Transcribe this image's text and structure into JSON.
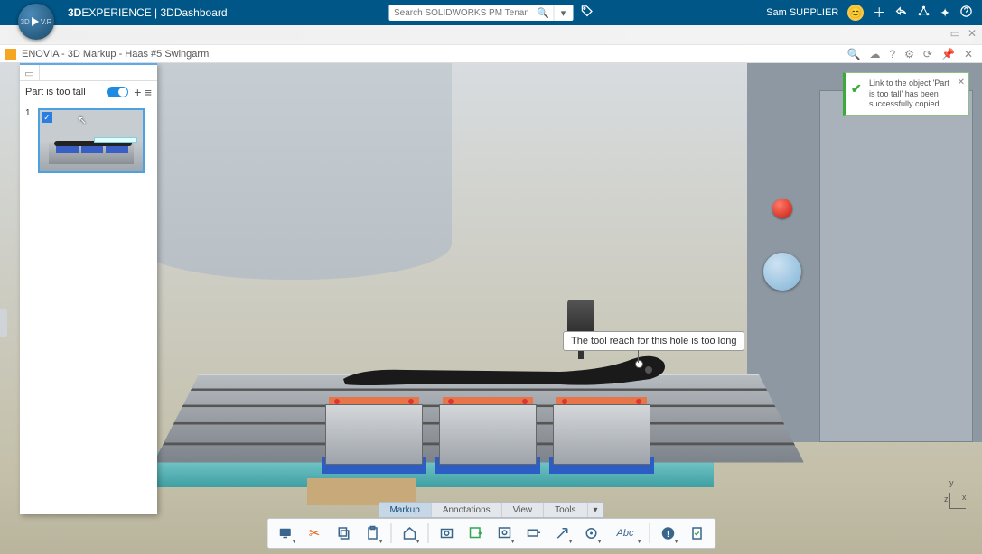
{
  "header": {
    "brand_prefix": "3D",
    "brand_mid": "EXPERIENCE",
    "brand_suffix": " | 3DDashboard",
    "search_placeholder": "Search SOLIDWORKS PM Tenant",
    "user_name": "Sam SUPPLIER"
  },
  "tab": {
    "title": "ENOVIA - 3D Markup - Haas #5 Swingarm"
  },
  "sidepanel": {
    "title": "Part is too tall",
    "slides": [
      {
        "index": "1."
      }
    ]
  },
  "callout": {
    "text": "The tool reach for this hole is too long"
  },
  "toast": {
    "text": "Link to the object 'Part is too tall' has been successfully copied"
  },
  "ribbon": {
    "tabs": [
      "Markup",
      "Annotations",
      "View",
      "Tools"
    ],
    "active": 0
  },
  "toolbar": {
    "abc_label": "Abc"
  },
  "triad": {
    "y": "y",
    "x": "x",
    "z": "z"
  }
}
